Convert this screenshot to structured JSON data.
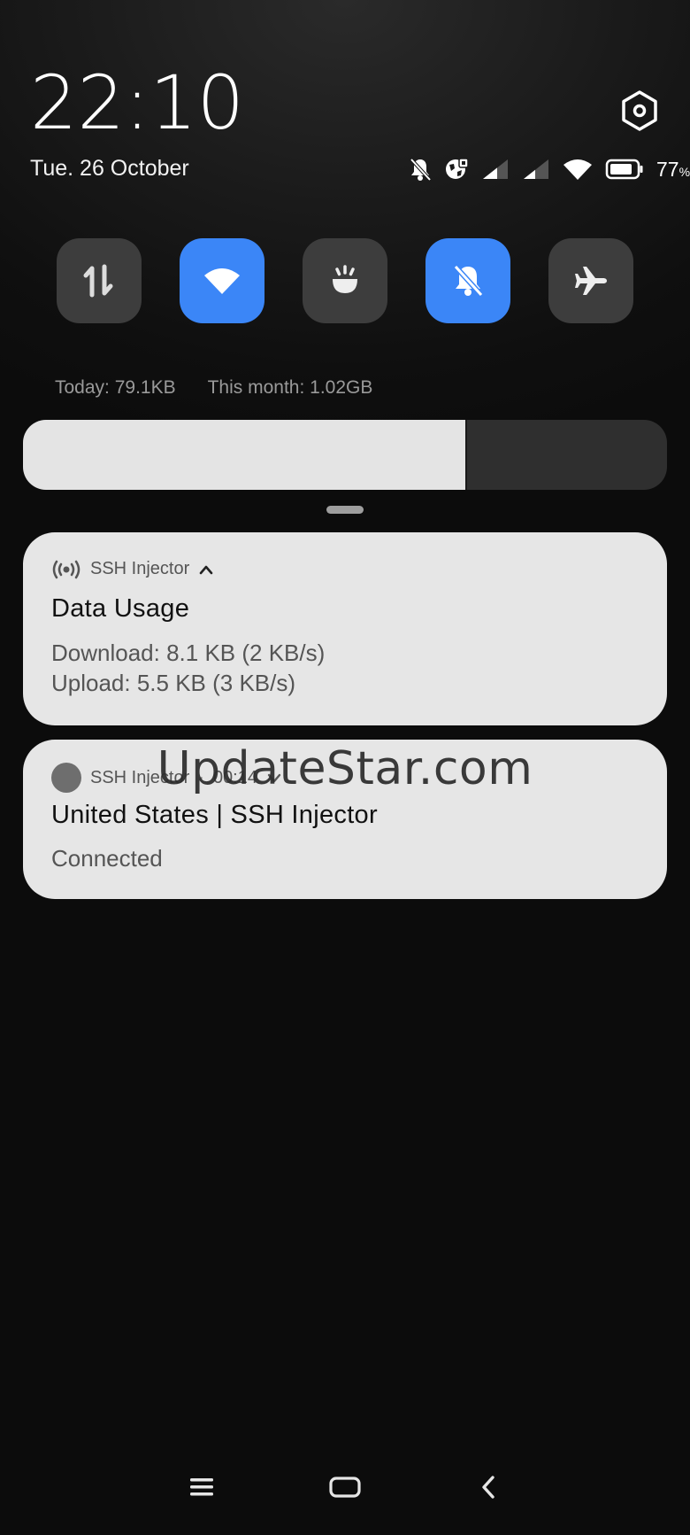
{
  "status": {
    "time": "22:10",
    "date": "Tue. 26 October",
    "battery_percent_value": "77",
    "battery_percent_unit": "%",
    "icons": [
      "mute-bell-icon",
      "vpn-globe-icon",
      "signal-1-icon",
      "signal-2-icon",
      "wifi-icon",
      "battery-icon"
    ]
  },
  "quick_settings": {
    "tiles": [
      {
        "name": "mobile-data",
        "icon": "data-arrows-icon",
        "active": false
      },
      {
        "name": "wifi",
        "icon": "wifi-icon",
        "active": true
      },
      {
        "name": "flashlight",
        "icon": "flashlight-icon",
        "active": false
      },
      {
        "name": "mute",
        "icon": "bell-off-icon",
        "active": true
      },
      {
        "name": "airplane-mode",
        "icon": "airplane-icon",
        "active": false
      }
    ],
    "accent_color": "#3b86f7"
  },
  "usage": {
    "today": "Today: 79.1KB",
    "month": "This month: 1.02GB"
  },
  "brightness": {
    "level": 0.69
  },
  "notifications": [
    {
      "app": "SSH Injector",
      "title": "Data Usage",
      "line1": "Download: 8.1 KB (2 KB/s)",
      "line2": "Upload: 5.5 KB (3 KB/s)"
    },
    {
      "app": "SSH Injector",
      "sep": "·",
      "time": "00:14",
      "title": "United States | SSH Injector",
      "line1": "Connected"
    }
  ],
  "watermark": "UpdateStar.com"
}
